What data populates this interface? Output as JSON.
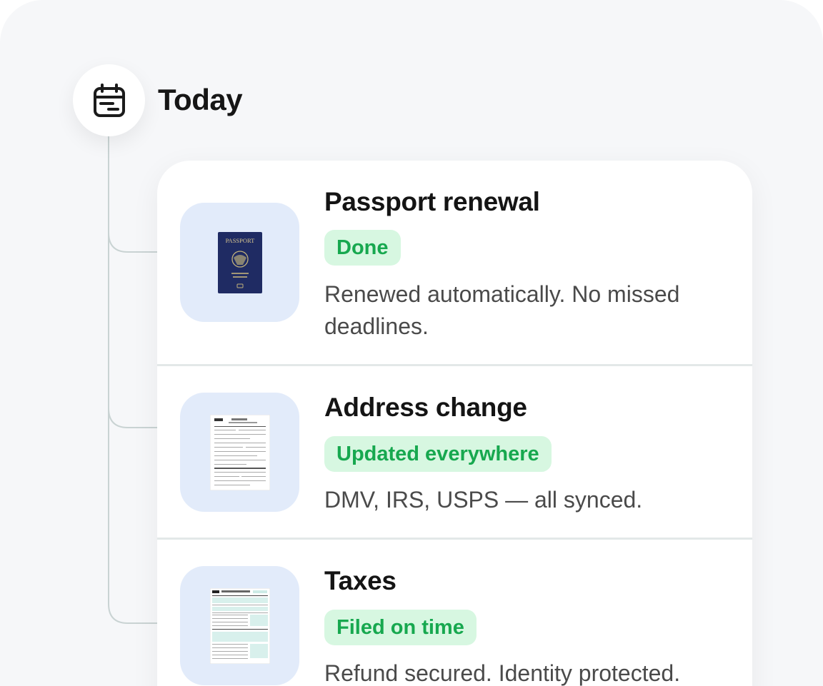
{
  "header": {
    "title": "Today",
    "icon": "calendar-icon"
  },
  "colors": {
    "panel_bg": "#f6f7f9",
    "thumb_bg": "#e2ebfa",
    "badge_bg": "#d7f7e1",
    "badge_text": "#17a84f",
    "connector": "#c9d3d3"
  },
  "tasks": [
    {
      "title": "Passport renewal",
      "status": "Done",
      "description": "Renewed automatically. No missed deadlines.",
      "thumbnail": "passport-image",
      "thumbnail_text": "PASSPORT"
    },
    {
      "title": "Address change",
      "status": "Updated everywhere",
      "description": "DMV, IRS, USPS — all synced.",
      "thumbnail": "address-change-form-image"
    },
    {
      "title": "Taxes",
      "status": "Filed on time",
      "description": "Refund secured. Identity protected.",
      "thumbnail": "tax-form-image"
    }
  ]
}
